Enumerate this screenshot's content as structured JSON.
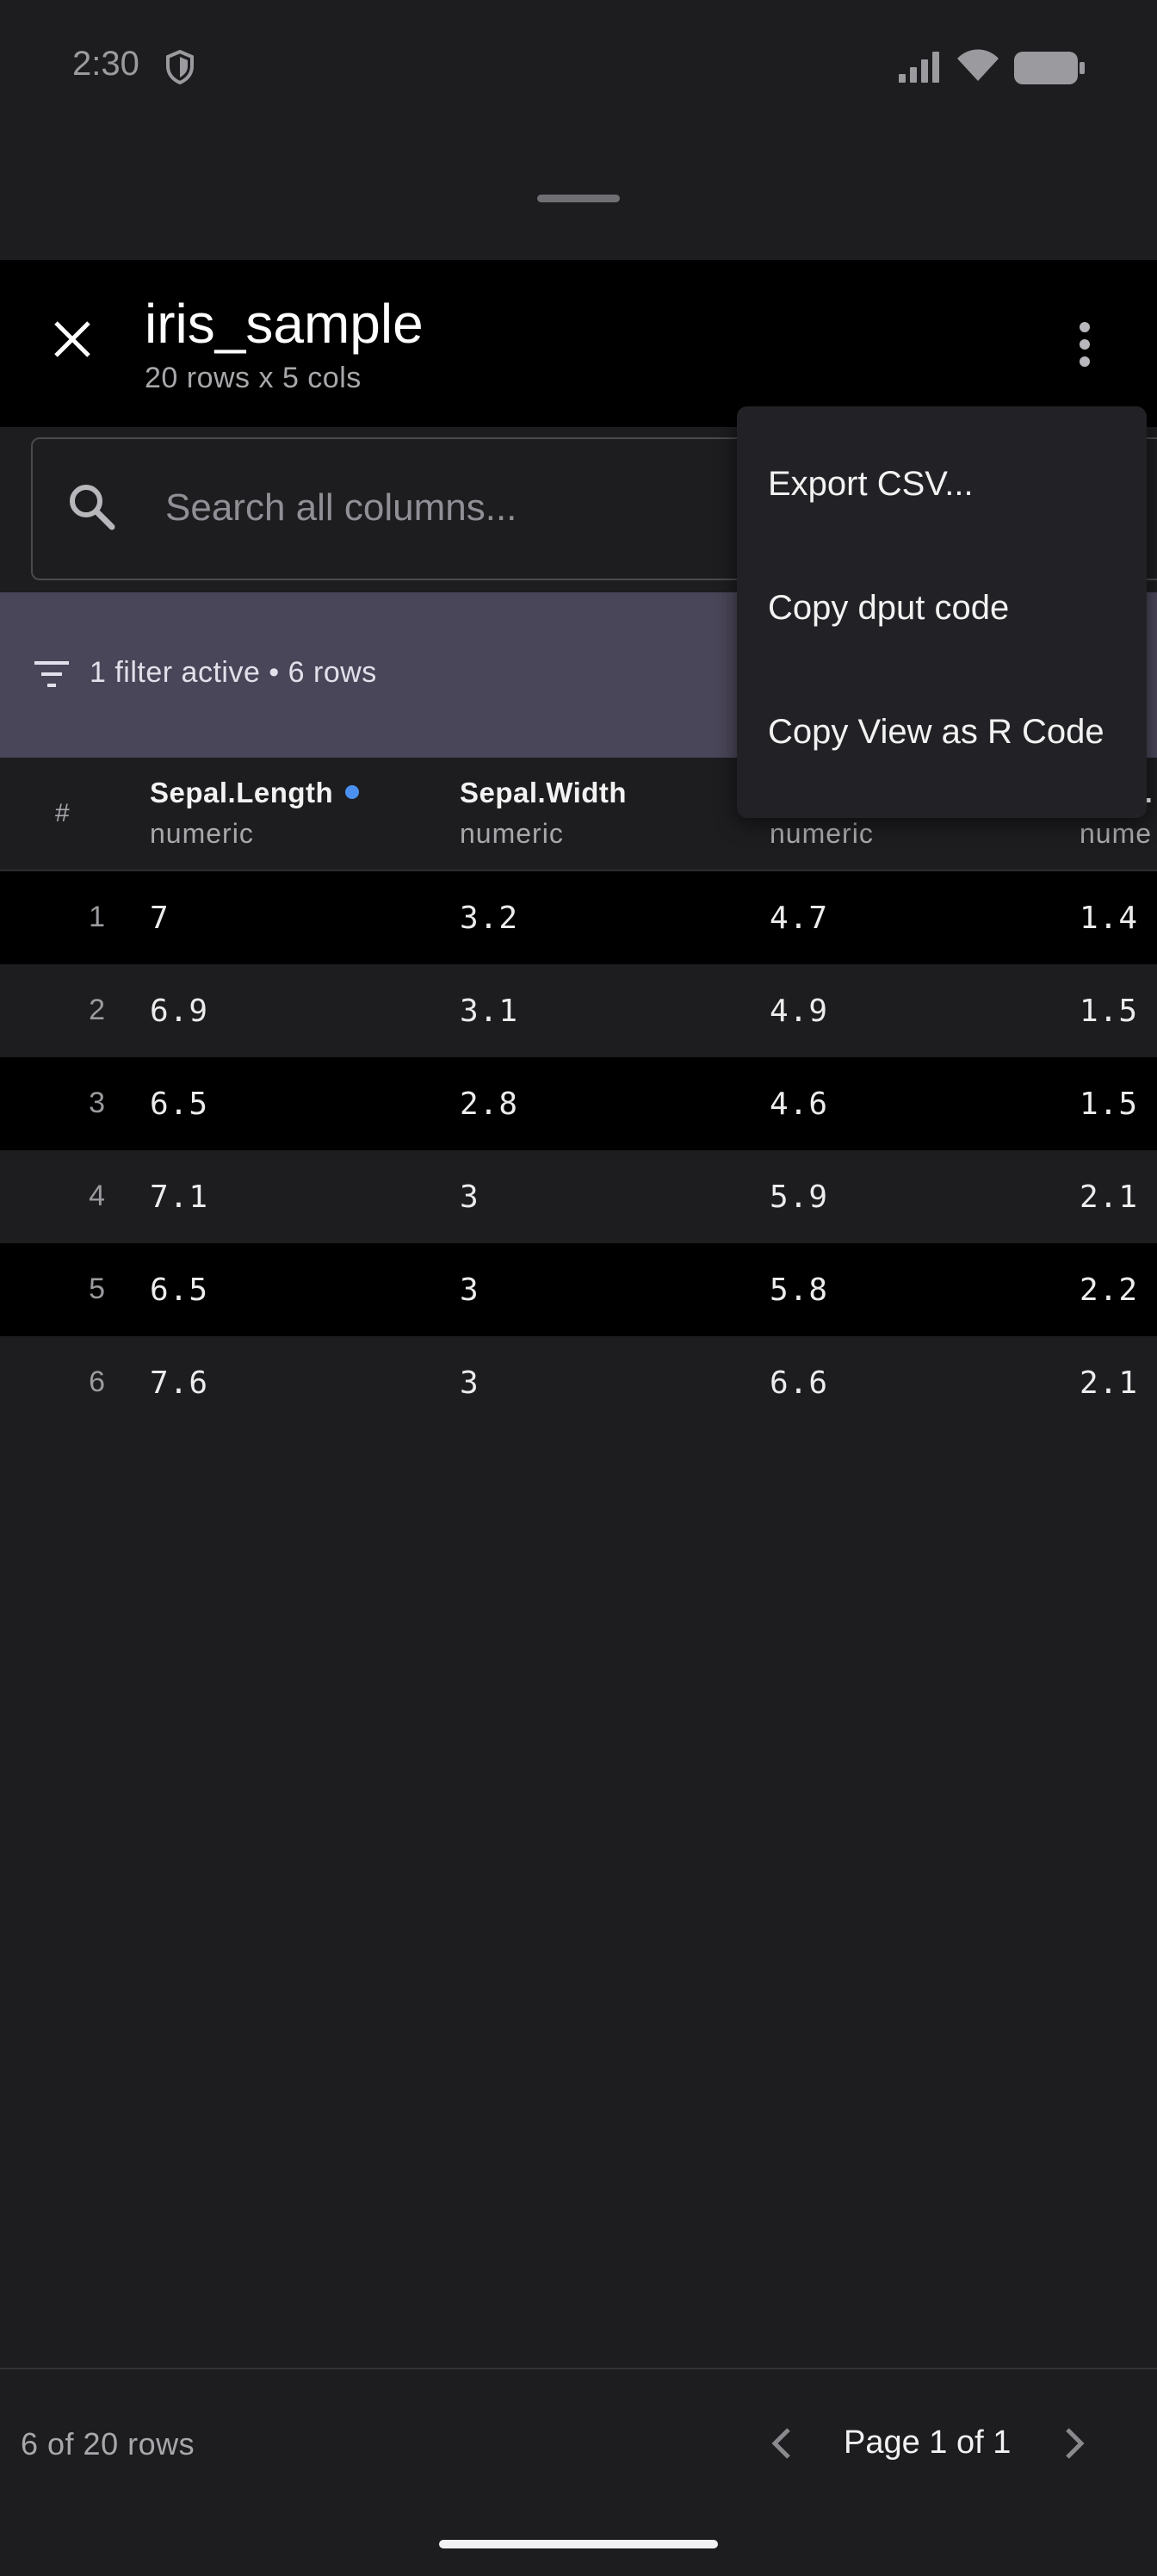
{
  "status_bar": {
    "time": "2:30"
  },
  "header": {
    "title": "iris_sample",
    "subtitle": "20 rows x 5 cols"
  },
  "search": {
    "placeholder": "Search all columns..."
  },
  "filter_bar": {
    "text": "1 filter active • 6 rows"
  },
  "table": {
    "index_header": "#",
    "columns": [
      {
        "name": "Sepal.Length",
        "type": "numeric",
        "sorted": true
      },
      {
        "name": "Sepal.Width",
        "type": "numeric",
        "sorted": false
      },
      {
        "name": "",
        "type": "numeric",
        "sorted": false
      },
      {
        "name": "l.",
        "type": "nume",
        "sorted": false
      }
    ],
    "rows": [
      {
        "index": "1",
        "cells": [
          "7",
          "3.2",
          "4.7",
          "1.4"
        ]
      },
      {
        "index": "2",
        "cells": [
          "6.9",
          "3.1",
          "4.9",
          "1.5"
        ]
      },
      {
        "index": "3",
        "cells": [
          "6.5",
          "2.8",
          "4.6",
          "1.5"
        ]
      },
      {
        "index": "4",
        "cells": [
          "7.1",
          "3",
          "5.9",
          "2.1"
        ]
      },
      {
        "index": "5",
        "cells": [
          "6.5",
          "3",
          "5.8",
          "2.2"
        ]
      },
      {
        "index": "6",
        "cells": [
          "7.6",
          "3",
          "6.6",
          "2.1"
        ]
      }
    ]
  },
  "menu": {
    "items": [
      "Export CSV...",
      "Copy dput code",
      "Copy View as R Code"
    ]
  },
  "footer": {
    "row_count": "6 of 20 rows",
    "page_label": "Page 1 of 1"
  },
  "colors": {
    "background": "#1d1d20",
    "header_bg": "#000000",
    "filter_bar_bg": "#4a4659",
    "sort_indicator": "#4b8ff0",
    "menu_bg": "#222226"
  },
  "icons": [
    "shield-icon",
    "signal-icon",
    "wifi-icon",
    "battery-icon",
    "close-icon",
    "more-vert-icon",
    "search-icon",
    "filter-icon",
    "chevron-left-icon",
    "chevron-right-icon"
  ]
}
